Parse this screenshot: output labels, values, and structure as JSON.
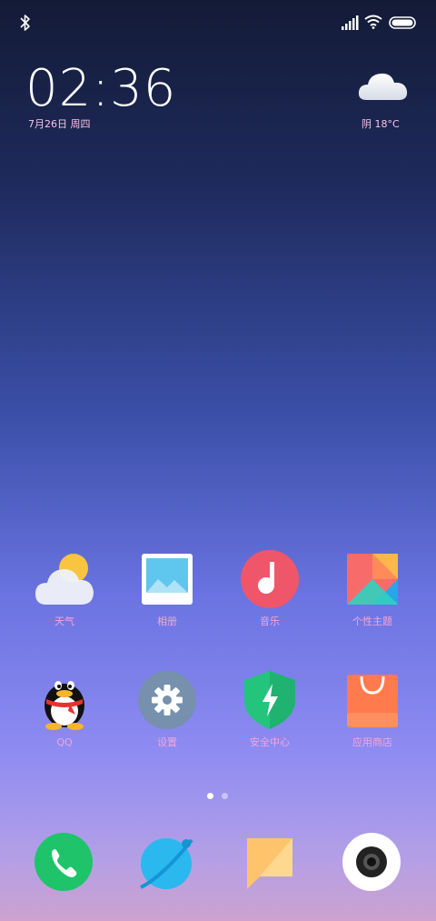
{
  "status_bar": {
    "icons": [
      "bluetooth-icon",
      "signal-icon",
      "wifi-icon",
      "battery-icon"
    ]
  },
  "lock_info": {
    "time": "02:36",
    "date": "7月26日 周四",
    "weather": "阴  18°C",
    "weather_icon": "cloud-icon"
  },
  "home": {
    "row1": [
      {
        "label": "天气",
        "icon": "weather-icon"
      },
      {
        "label": "相册",
        "icon": "gallery-icon"
      },
      {
        "label": "音乐",
        "icon": "music-icon"
      },
      {
        "label": "个性主题",
        "icon": "themes-icon"
      }
    ],
    "row2": [
      {
        "label": "QQ",
        "icon": "qq-penguin-icon"
      },
      {
        "label": "设置",
        "icon": "settings-gear-icon"
      },
      {
        "label": "安全中心",
        "icon": "security-shield-icon"
      },
      {
        "label": "应用商店",
        "icon": "app-store-bag-icon"
      }
    ]
  },
  "page_indicator": {
    "pages": 2,
    "current": 1
  },
  "dock": [
    {
      "name": "phone",
      "icon": "phone-icon"
    },
    {
      "name": "browser",
      "icon": "browser-planet-icon"
    },
    {
      "name": "messages",
      "icon": "messages-icon"
    },
    {
      "name": "camera",
      "icon": "camera-icon"
    }
  ],
  "colors": {
    "phone": "#1fc46a",
    "browser": "#2ab8ef",
    "messages": "#ffc46b",
    "camera": "#ffffff",
    "music": "#f0566a",
    "security": "#24c47c",
    "store": "#ff7a4c",
    "settings": "#7690ad"
  }
}
